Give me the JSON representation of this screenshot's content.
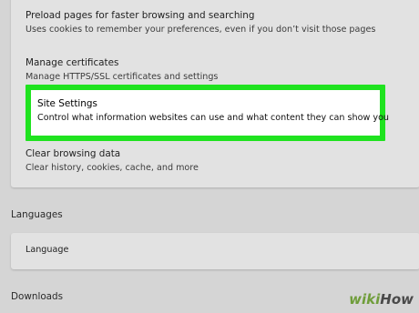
{
  "privacy": {
    "preload": {
      "title": "Preload pages for faster browsing and searching",
      "description": "Uses cookies to remember your preferences, even if you don’t visit those pages"
    },
    "certificates": {
      "title": "Manage certificates",
      "description": "Manage HTTPS/SSL certificates and settings"
    },
    "site_settings": {
      "title": "Site Settings",
      "description": "Control what information websites can use and what content they can show you"
    },
    "clear_data": {
      "title": "Clear browsing data",
      "description": "Clear history, cookies, cache, and more"
    }
  },
  "languages": {
    "heading": "Languages",
    "language_label": "Language"
  },
  "downloads": {
    "heading": "Downloads"
  },
  "watermark": {
    "wiki": "wiki",
    "how": "How"
  },
  "colors": {
    "highlight": "#1fe31f",
    "background": "#d5d5d5",
    "card": "#e2e2e2"
  }
}
